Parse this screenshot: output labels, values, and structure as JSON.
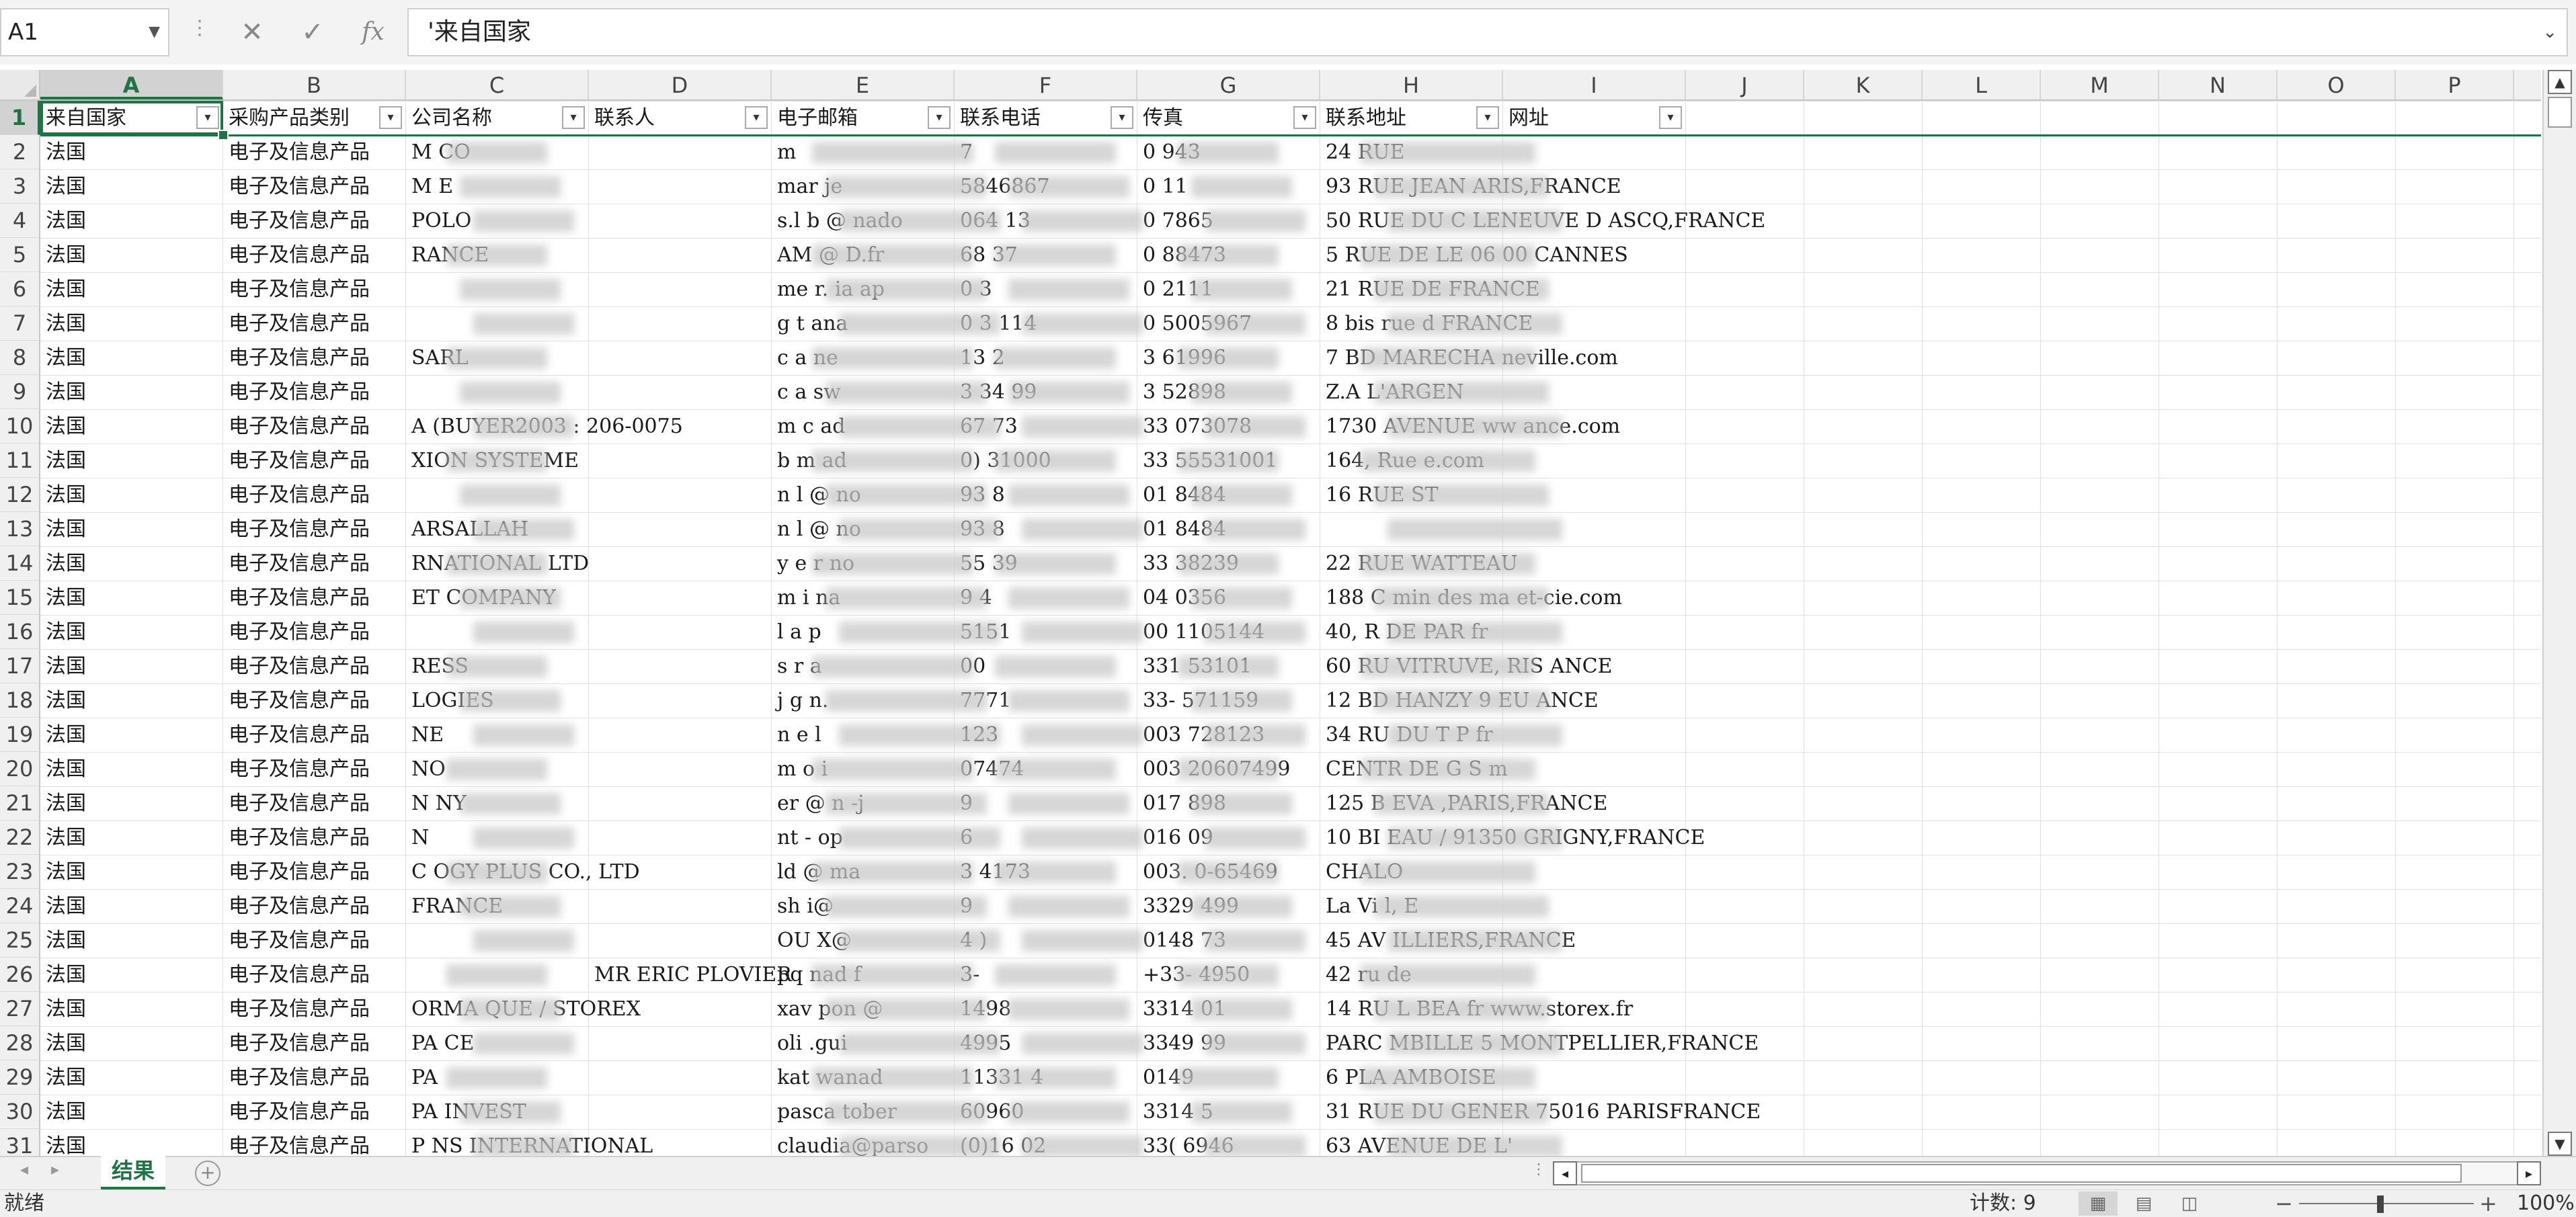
{
  "formula_bar": {
    "name_box": "A1",
    "cancel_icon": "✕",
    "enter_icon": "✓",
    "fx_label": "fx",
    "formula": "'来自国家"
  },
  "columns": [
    "A",
    "B",
    "C",
    "D",
    "E",
    "F",
    "G",
    "H",
    "I",
    "J",
    "K",
    "L",
    "M",
    "N",
    "O",
    "P"
  ],
  "headers": [
    "来自国家",
    "采购产品类别",
    "公司名称",
    "联系人",
    "电子邮箱",
    "联系电话",
    "传真",
    "联系地址",
    "网址"
  ],
  "rows": [
    {
      "n": "2",
      "a": "法国",
      "b": "电子及信息产品",
      "c": "M    CO",
      "d": "",
      "e": "m",
      "f": "7",
      "g": "0          943",
      "h": "24 RUE"
    },
    {
      "n": "3",
      "a": "法国",
      "b": "电子及信息产品",
      "c": "M       E",
      "d": "",
      "e": "mar      je",
      "f": "5846867",
      "g": "0        11",
      "h": "93 RUE JEAN          ARIS,FRANCE"
    },
    {
      "n": "4",
      "a": "法国",
      "b": "电子及信息产品",
      "c": "      POLO",
      "d": "",
      "e": "s.l    b    @   nado",
      "f": "064   13",
      "g": "0        7865",
      "h": "50 RUE DU C                    LENEUVE D ASCQ,FRANCE"
    },
    {
      "n": "5",
      "a": "法国",
      "b": "电子及信息产品",
      "c": "     RANCE",
      "d": "",
      "e": "AM    @    D.fr",
      "f": "68   37",
      "g": "0      88473",
      "h": "5 RUE DE LE     06  00 CANNES"
    },
    {
      "n": "6",
      "a": "法国",
      "b": "电子及信息产品",
      "c": "",
      "d": "",
      "e": "me   r.    ia   ap",
      "f": "0  3",
      "g": "0      2111",
      "h": "21 RUE DE            FRANCE"
    },
    {
      "n": "7",
      "a": "法国",
      "b": "电子及信息产品",
      "c": "",
      "d": "",
      "e": "g   t    ana",
      "f": "0  3    114",
      "g": "0      5005967",
      "h": "8 bis rue d      FRANCE"
    },
    {
      "n": "8",
      "a": "法国",
      "b": "电子及信息产品",
      "c": "         SARL",
      "d": "",
      "e": "c     a      ne",
      "f": "13       2",
      "g": "3        61996",
      "h": "7 BD MARECHA              neville.com"
    },
    {
      "n": "9",
      "a": "法国",
      "b": "电子及信息产品",
      "c": "",
      "d": "",
      "e": "c     a     sw",
      "f": "3  34    99",
      "g": "3        52898",
      "h": "Z.A L'ARGEN"
    },
    {
      "n": "10",
      "a": "法国",
      "b": "电子及信息产品",
      "c": "         A     (BUYER2003 : 206-0075",
      "d": "",
      "e": "m    c       ad",
      "f": "67    73",
      "g": "33      073078",
      "h": "1730 AVENUE       ww        ance.com"
    },
    {
      "n": "11",
      "a": "法国",
      "b": "电子及信息产品",
      "c": "         XION SYSTEME",
      "d": "",
      "e": "b     m       ad",
      "f": "0)      31000",
      "g": "33       55531001",
      "h": "164, Rue                     e.com"
    },
    {
      "n": "12",
      "a": "法国",
      "b": "电子及信息产品",
      "c": "",
      "d": "",
      "e": "n     l    @    no",
      "f": "93      8",
      "g": "01       8484",
      "h": "16 RUE ST"
    },
    {
      "n": "13",
      "a": "法国",
      "b": "电子及信息产品",
      "c": "         ARSALLAH",
      "d": "",
      "e": "n     l    @    no",
      "f": "93      8",
      "g": "01       8484",
      "h": ""
    },
    {
      "n": "14",
      "a": "法国",
      "b": "电子及信息产品",
      "c": "         RNATIONAL LTD",
      "d": "",
      "e": "y      e    r    no",
      "f": "55     39",
      "g": "33       38239",
      "h": "22 RUE WATTEAU"
    },
    {
      "n": "15",
      "a": "法国",
      "b": "电子及信息产品",
      "c": "         ET COMPANY",
      "d": "",
      "e": "m     i    na",
      "f": "9    4",
      "g": "04       0356",
      "h": "188 C  min des              ma    et-cie.com"
    },
    {
      "n": "16",
      "a": "法国",
      "b": "电子及信息产品",
      "c": "",
      "d": "",
      "e": "l      a     p",
      "f": "5151",
      "g": "00       1105144",
      "h": "40, R  DE PAR           fr"
    },
    {
      "n": "17",
      "a": "法国",
      "b": "电子及信息产品",
      "c": "         RESS",
      "d": "",
      "e": "s    r     a",
      "f": "00",
      "g": "331      53101",
      "h": "60 RU  VITRUVE,       RIS  ANCE"
    },
    {
      "n": "18",
      "a": "法国",
      "b": "电子及信息产品",
      "c": "         LOGIES",
      "d": "",
      "e": "j     g    n.",
      "f": "7771",
      "g": "33-      571159",
      "h": "12 BD   HANZY  9         EU     ANCE"
    },
    {
      "n": "19",
      "a": "法国",
      "b": "电子及信息产品",
      "c": "NE",
      "d": "",
      "e": "n     e    l",
      "f": "123",
      "g": "003      728123",
      "h": "34 RU  DU  T  P            fr"
    },
    {
      "n": "20",
      "a": "法国",
      "b": "电子及信息产品",
      "c": "NO",
      "d": "",
      "e": "m     o    i",
      "f": "07474",
      "g": "003      20607499",
      "h": "CENTR  DE  G    S                 m"
    },
    {
      "n": "21",
      "a": "法国",
      "b": "电子及信息产品",
      "c": "N      NY",
      "d": "",
      "e": "er    @   n    -j",
      "f": "9",
      "g": "017      898",
      "h": "125 B     EVA                  ,PARIS,FRANCE"
    },
    {
      "n": "22",
      "a": "法国",
      "b": "电子及信息产品",
      "c": "N",
      "d": "",
      "e": "nt    -    op",
      "f": "6",
      "g": "016      09",
      "h": "10 BI                        EAU / 91350 GRIGNY,FRANCE"
    },
    {
      "n": "23",
      "a": "法国",
      "b": "电子及信息产品",
      "c": "C        OGY PLUS CO., LTD",
      "d": "",
      "e": "ld     @   ma",
      "f": "3    4173",
      "g": "003.      0-65469",
      "h": "CHALO"
    },
    {
      "n": "24",
      "a": "法国",
      "b": "电子及信息产品",
      "c": "          FRANCE",
      "d": "",
      "e": "sh    i@",
      "f": "9",
      "g": "3329      499",
      "h": "La Vi          l,      E"
    },
    {
      "n": "25",
      "a": "法国",
      "b": "电子及信息产品",
      "c": "",
      "d": "",
      "e": "OU     X@",
      "f": "4    )",
      "g": "0148      73",
      "h": "45 AV                       ILLIERS,FRANCE"
    },
    {
      "n": "26",
      "a": "法国",
      "b": "电子及信息产品",
      "c": "",
      "d": "MR ERIC PLOVIER",
      "e": "pq      nad      f",
      "f": "3-",
      "g": "+33-      4950",
      "h": "42 ru   de"
    },
    {
      "n": "27",
      "a": "法国",
      "b": "电子及信息产品",
      "c": "         ORMA   QUE / STOREX",
      "d": "",
      "e": "xav     pon     @",
      "f": "1498",
      "g": "3314      01",
      "h": "14 RU   L  BEA                fr www.storex.fr"
    },
    {
      "n": "28",
      "a": "法国",
      "b": "电子及信息产品",
      "c": "PA       CE",
      "d": "",
      "e": "oli     .gui",
      "f": "4995",
      "g": "3349      99",
      "h": "PARC     MBILLE              5 MONTPELLIER,FRANCE"
    },
    {
      "n": "29",
      "a": "法国",
      "b": "电子及信息产品",
      "c": "PA",
      "d": "",
      "e": "kat     wanad",
      "f": "11331   4",
      "g": "0149",
      "h": "6 PLA   AMBOISE"
    },
    {
      "n": "30",
      "a": "法国",
      "b": "电子及信息产品",
      "c": "PA        INVEST",
      "d": "",
      "e": "pasca   tober",
      "f": "60960",
      "g": "3314      5",
      "h": "31 RUE DU GENER              75016 PARISFRANCE"
    },
    {
      "n": "31",
      "a": "法国",
      "b": "电子及信息产品",
      "c": "P       NS INTERNATIONAL",
      "d": "",
      "e": "claudia@parso",
      "f": "(0)16     02",
      "g": "33(      6946",
      "h": "63 AVENUE DE L'"
    }
  ],
  "sheet_tab": "结果",
  "status": {
    "ready": "就绪",
    "count": "计数: 9",
    "zoom": "100%"
  },
  "colors": {
    "accent": "#217346",
    "grid": "#e2e2e2",
    "header_bg": "#f0f0f0"
  },
  "icons": [
    "dropdown-icon",
    "cancel-icon",
    "enter-icon",
    "fx-icon",
    "filter-dropdown-icon",
    "add-sheet-icon",
    "normal-view-icon",
    "page-layout-icon",
    "page-break-icon"
  ]
}
